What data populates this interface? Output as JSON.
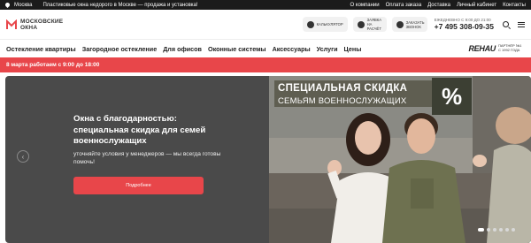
{
  "topbar": {
    "city": "Москва",
    "promo": "Пластиковые окна недорого в Москве — продажа и установка!",
    "links": [
      "О компании",
      "Оплата заказа",
      "Доставка",
      "Личный кабинет",
      "Контакты"
    ]
  },
  "header": {
    "logo_line1": "МОСКОВСКИЕ",
    "logo_line2": "ОКНА",
    "buttons": [
      {
        "label": "КАЛЬКУЛЯТОР",
        "icon": "calculator-icon"
      },
      {
        "label": "ЗАЯВКА НА РАСЧЁТ",
        "icon": "car-icon"
      },
      {
        "label": "ЗАКАЗАТЬ ЗВОНОК",
        "icon": "phone-icon"
      }
    ],
    "hours": "ЕЖЕДНЕВНО С 9:00 ДО 21:00",
    "phone": "+7 495 308-09-35"
  },
  "nav": {
    "items": [
      "Остекление квартиры",
      "Загородное остекление",
      "Для офисов",
      "Оконные системы",
      "Аксессуары",
      "Услуги",
      "Цены"
    ],
    "partner_mark": "REHAU",
    "partner_caption": "ПАРТНЁР №1 С 1992 ГОДА"
  },
  "alert": {
    "text": "8 марта работаем с 9:00 до 18:00"
  },
  "hero": {
    "title": "Окна с благодарностью: специальная скидка для семей военнослужащих",
    "subtitle": "уточняйте условия у менеджеров — мы всегда готовы помочь!",
    "cta": "Подробнее",
    "banner_line1": "СПЕЦИАЛЬНАЯ СКИДКА",
    "banner_line2": "СЕМЬЯМ ВОЕННОСЛУЖАЩИХ",
    "percent": "%",
    "slides_total": 6,
    "slide_active": 1
  },
  "colors": {
    "accent": "#e8464a",
    "dark": "#1b1b1b",
    "panel": "#4a4a4a"
  }
}
